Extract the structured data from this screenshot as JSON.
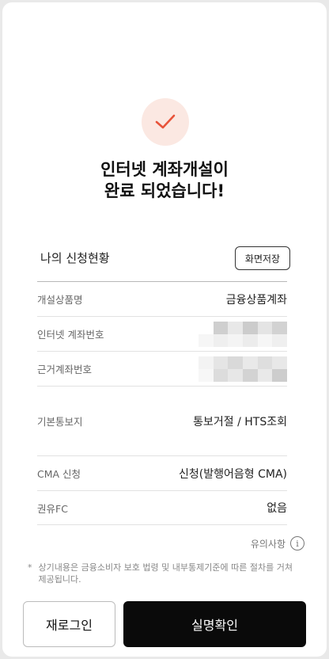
{
  "headline": {
    "line1": "인터넷 계좌개설이",
    "line2": "완료 되었습니다!"
  },
  "section": {
    "title": "나의 신청현황",
    "save_label": "화면저장"
  },
  "rows": [
    {
      "label": "개설상품명",
      "value": "금융상품계좌"
    },
    {
      "label": "인터넷 계좌번호",
      "value": ""
    },
    {
      "label": "근거계좌번호",
      "value": ""
    },
    {
      "label": "기본통보지",
      "value": "통보거절 / HTS조회"
    },
    {
      "label": "CMA 신청",
      "value": "신청(발행어음형 CMA)"
    },
    {
      "label": "권유FC",
      "value": "없음"
    }
  ],
  "notice": {
    "label": "유의사항",
    "icon": "info-icon"
  },
  "disclaimer": {
    "bullet": "*",
    "text": "상기내용은 금융소비자 보호 법령 및 내부통제기준에 따른 절차를 거쳐 제공됩니다."
  },
  "buttons": {
    "relogin": "재로그인",
    "verify": "실명확인"
  },
  "colors": {
    "accent": "#e8533a",
    "check_bg": "#fbe8e2",
    "primary_button": "#0a0a0a"
  }
}
